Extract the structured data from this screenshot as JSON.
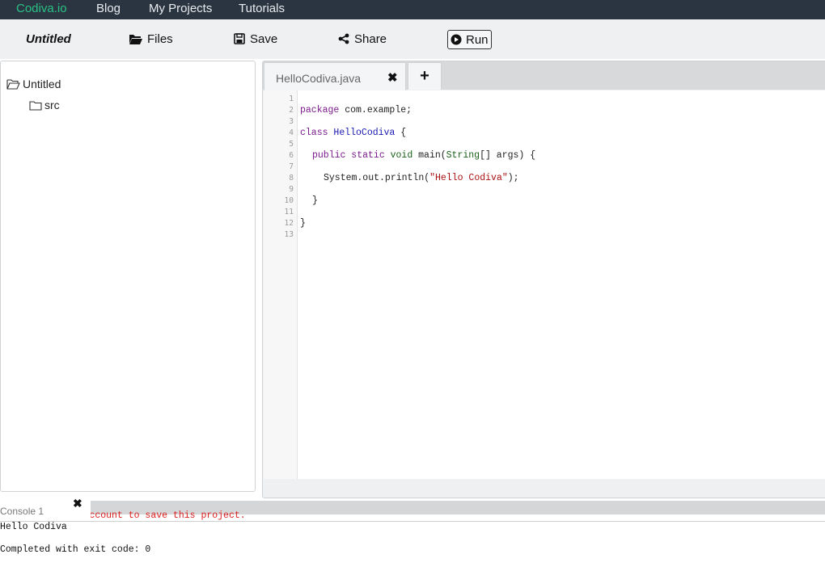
{
  "navbar": {
    "brand": "Codiva.io",
    "links": [
      "Blog",
      "My Projects",
      "Tutorials"
    ]
  },
  "toolbar": {
    "project_title": "Untitled",
    "files_label": "Files",
    "save_label": "Save",
    "share_label": "Share",
    "run_label": "Run"
  },
  "file_tree": {
    "root": "Untitled",
    "children": [
      "src"
    ]
  },
  "editor": {
    "active_tab": "HelloCodiva.java",
    "close_glyph": "✖",
    "add_tab_glyph": "+",
    "line_numbers": [
      "1",
      "2",
      "3",
      "4",
      "5",
      "6",
      "7",
      "8",
      "9",
      "10",
      "11",
      "12",
      "13"
    ],
    "code": {
      "l2_kw": "package",
      "l2_rest": " com.example;",
      "l4_kw": "class",
      "l4_name": "HelloCodiva",
      "l4_rest": " {",
      "l6_kw": "public static",
      "l6_type": "void",
      "l6_mid": " main(",
      "l6_type2": "String",
      "l6_rest": "[] args) {",
      "l8_call": "System.out.println(",
      "l8_str": "\"Hello Codiva\"",
      "l8_rest": ");",
      "l10": "}",
      "l12": "}"
    }
  },
  "console": {
    "tab_label": "Console 1",
    "close_glyph": "✖",
    "lines": [
      "Login / Create Account to save this project.",
      "Hello Codiva",
      "",
      "Completed with exit code: 0"
    ]
  },
  "colors": {
    "navbar_bg": "#2b3541",
    "brand": "#29c183",
    "keyword": "#7b1a8c",
    "string": "#aa1111",
    "console_notice": "#dd2222"
  }
}
